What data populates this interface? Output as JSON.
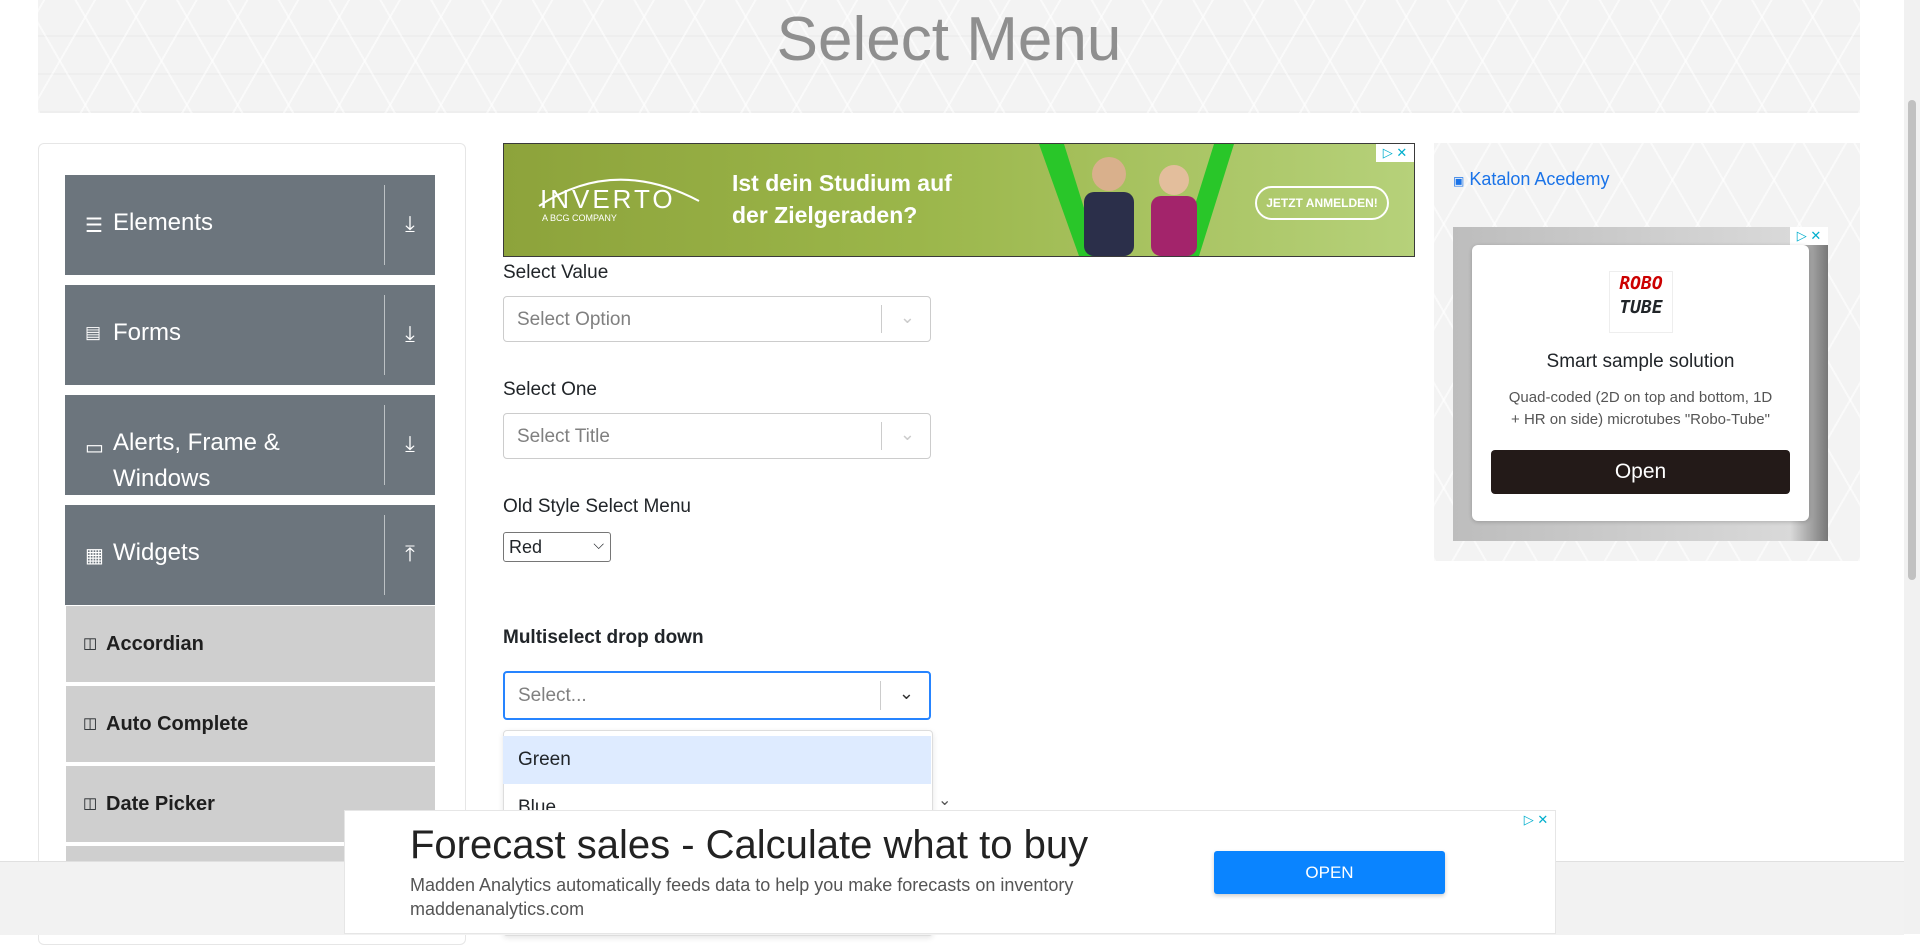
{
  "page": {
    "title": "Select Menu"
  },
  "sidebar": {
    "groups": [
      {
        "label": "Elements",
        "icon": "list-icon",
        "toggle_icon": "download-arrow-icon"
      },
      {
        "label": "Forms",
        "icon": "form-icon",
        "toggle_icon": "download-arrow-icon"
      },
      {
        "label": "Alerts, Frame &",
        "label2": "Windows",
        "icon": "window-icon",
        "toggle_icon": "download-arrow-icon"
      },
      {
        "label": "Widgets",
        "icon": "widgets-icon",
        "toggle_icon": "upload-arrow-icon"
      }
    ],
    "widget_items": [
      {
        "label": "Accordian"
      },
      {
        "label": "Auto Complete"
      },
      {
        "label": "Date Picker"
      }
    ]
  },
  "top_ad": {
    "brand": "INVERTO",
    "brand_sub": "A BCG COMPANY",
    "headline_line1": "Ist dein Studium auf",
    "headline_line2": "der Zielgeraden?",
    "cta": "JETZT ANMELDEN!"
  },
  "form": {
    "select_value": {
      "label": "Select Value",
      "placeholder": "Select Option"
    },
    "select_one": {
      "label": "Select One",
      "placeholder": "Select Title"
    },
    "old_style": {
      "label": "Old Style Select Menu",
      "selected": "Red"
    },
    "multiselect": {
      "label": "Multiselect drop down",
      "placeholder": "Select...",
      "options": [
        "Green",
        "Blue"
      ]
    }
  },
  "right_ad": {
    "link_text": "Katalon Acedemy",
    "logo_line1": "ROBO",
    "logo_line2": "TUBE",
    "title": "Smart sample solution",
    "desc_line1": "Quad-coded (2D on top and bottom, 1D",
    "desc_line2": "+ HR on side) microtubes \"Robo-Tube\"",
    "button": "Open"
  },
  "bottom_ad": {
    "title": "Forecast sales - Calculate what to buy",
    "desc": "Madden Analytics automatically feeds data to help you make forecasts on inventory",
    "domain": "maddenanalytics.com",
    "button": "OPEN"
  },
  "colors": {
    "sidebar_group": "#6c757d",
    "sidebar_item": "#cfcfcf",
    "focus_blue": "#2684ff",
    "ad_button_blue": "#0a84ff"
  }
}
